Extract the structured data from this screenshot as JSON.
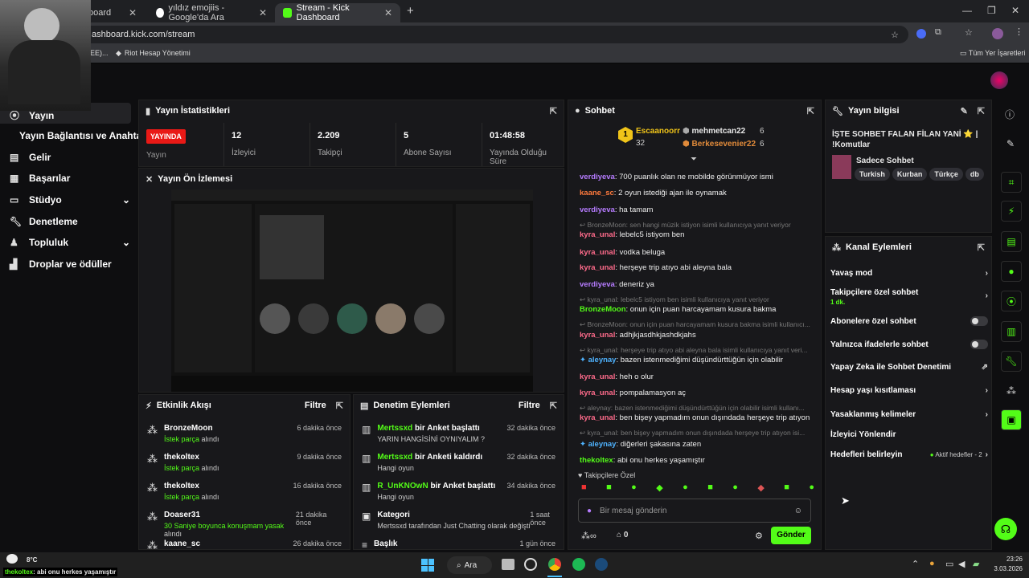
{
  "browser": {
    "tabs": [
      {
        "label": "board"
      },
      {
        "label": "yıldız emojiis - Google'da Ara"
      },
      {
        "label": "Stream - Kick Dashboard"
      }
    ],
    "url": "ashboard.kick.com/stream",
    "bookmarks": [
      "EE)...",
      "Riot Hesap Yönetimi"
    ],
    "all_bookmarks": "Tüm Yer İşaretleri"
  },
  "sidebar": {
    "items": [
      {
        "label": "Yayın",
        "icon": "broadcast-icon"
      },
      {
        "label": "Yayın Bağlantısı ve Anahtarı"
      },
      {
        "label": "Gelir",
        "icon": "revenue-icon"
      },
      {
        "label": "Başarılar",
        "icon": "achievements-icon"
      },
      {
        "label": "Stüdyo",
        "icon": "studio-icon"
      },
      {
        "label": "Denetleme",
        "icon": "wrench-icon"
      },
      {
        "label": "Topluluk",
        "icon": "community-icon"
      },
      {
        "label": "Droplar ve ödüller",
        "icon": "drops-icon"
      }
    ]
  },
  "stats": {
    "title": "Yayın İstatistikleri",
    "live_badge": "YAYINDA",
    "live_label": "Yayın",
    "viewers": {
      "value": "12",
      "label": "İzleyici"
    },
    "followers": {
      "value": "2.209",
      "label": "Takipçi"
    },
    "subs": {
      "value": "5",
      "label": "Abone Sayısı"
    },
    "uptime": {
      "value": "01:48:58",
      "label": "Yayında Olduğu Süre"
    }
  },
  "preview": {
    "title": "Yayın Ön İzlemesi"
  },
  "activity": {
    "title": "Etkinlik Akışı",
    "filter": "Filtre",
    "rows": [
      {
        "user": "BronzeMoon",
        "highlight": "İstek parça",
        "rest": " alındı",
        "time": "6 dakika önce"
      },
      {
        "user": "thekoltex",
        "highlight": "İstek parça",
        "rest": " alındı",
        "time": "9 dakika önce"
      },
      {
        "user": "thekoltex",
        "highlight": "İstek parça",
        "rest": " alındı",
        "time": "16 dakika önce"
      },
      {
        "user": "Doaser31",
        "highlight": "30 Saniye boyunca konuşmam yasak",
        "rest": " alındı",
        "time": "21 dakika önce"
      },
      {
        "user": "kaane_sc",
        "highlight": "",
        "rest": "",
        "time": "26 dakika önce"
      }
    ]
  },
  "modlog": {
    "title": "Denetim Eylemleri",
    "filter": "Filtre",
    "rows": [
      {
        "user": "Mertssxd",
        "action": " bir Anket başlattı",
        "sub": "YARIN HANGİSİNİ OYNIYALIM ?",
        "time": "32 dakika önce"
      },
      {
        "user": "Mertssxd",
        "action": " bir Anketi kaldırdı",
        "sub": "Hangi oyun",
        "time": "32 dakika önce"
      },
      {
        "user": "R_UnKNOwN",
        "action": " bir Anket başlattı",
        "sub": "Hangi oyun",
        "time": "34 dakika önce"
      },
      {
        "user": "Kategori",
        "action": "",
        "sub": "Mertssxd tarafından Just Chatting olarak değiştirildi",
        "time": "1 saat önce"
      },
      {
        "user": "Başlık",
        "action": "",
        "sub": "",
        "time": "1 gün önce"
      }
    ]
  },
  "chat": {
    "title": "Sohbet",
    "leaders": [
      {
        "rank": "1",
        "name": "Escaanoorr",
        "count": "32"
      },
      {
        "name": "mehmetcan22",
        "count": "6"
      },
      {
        "name": "Berkesevenier22",
        "count": "6"
      }
    ],
    "messages": [
      {
        "user": "verdiyeva",
        "color": "#b67cff",
        "text": ": 700 puanlık olan ne mobilde görünmüyor ismi"
      },
      {
        "user": "kaane_sc",
        "color": "#ff7a3d",
        "text": ": 2 oyun istediği ajan ile oynamak"
      },
      {
        "user": "verdiyeva",
        "color": "#b67cff",
        "text": ": ha tamam"
      },
      {
        "reply": "BronzeMoon: sen hangi müzik istiyon isimli kullanıcıya yanıt veriyor"
      },
      {
        "user": "kyra_unal",
        "color": "#ff6b8b",
        "text": ": lebelc5 istiyom ben"
      },
      {
        "user": "kyra_unal",
        "color": "#ff6b8b",
        "text": ": vodka beluga"
      },
      {
        "user": "kyra_unal",
        "color": "#ff6b8b",
        "text": ": herşeye trip atıyo abi aleyna bala"
      },
      {
        "user": "verdiyeva",
        "color": "#b67cff",
        "text": ": deneriz ya"
      },
      {
        "reply": "kyra_unal: lebelc5 istiyom ben isimli kullanıcıya yanıt veriyor"
      },
      {
        "user": "BronzeMoon",
        "color": "#53fc18",
        "text": ": onun için puan harcayamam kusura bakma"
      },
      {
        "reply": "BronzeMoon: onun için puan harcayamam kusura bakma isimli kullanıcı..."
      },
      {
        "user": "kyra_unal",
        "color": "#ff6b8b",
        "text": ": adhjkjasdhkjashdkjahs"
      },
      {
        "reply": "kyra_unal: herşeye trip atıyo abi aleyna bala isimli kullanıcıya yanıt veri..."
      },
      {
        "user": "aleynay",
        "color": "#4fb3ff",
        "text": ": bazen istenmediğimi düşündürttüğün için olabilir"
      },
      {
        "user": "kyra_unal",
        "color": "#ff6b8b",
        "text": ": heh o olur"
      },
      {
        "user": "kyra_unal",
        "color": "#ff6b8b",
        "text": ": pompalamasyon aç"
      },
      {
        "reply": "aleynay: bazen istenmediğimi düşündürttüğün için olabilir isimli kullanı..."
      },
      {
        "user": "kyra_unal",
        "color": "#ff6b8b",
        "text": ": ben bişey yapmadım onun dışındada herşeye trip atıyon"
      },
      {
        "reply": "kyra_unal: ben bişey yapmadım onun dışındada herşeye trip atıyon isi..."
      },
      {
        "user": "aleynay",
        "color": "#4fb3ff",
        "text": ": diğerleri şakasına zaten"
      },
      {
        "user": "thekoltex",
        "color": "#53fc18",
        "text": ": abi onu herkes yaşamıştır"
      }
    ],
    "followers_only": "Takipçilere Özel",
    "placeholder": "Bir mesaj gönderin",
    "points": "0",
    "send": "Gönder"
  },
  "info": {
    "title": "Yayın bilgisi",
    "stream_title": "İŞTE SOHBET FALAN FİLAN YANİ ⭐ | !Komutlar",
    "category": "Sadece Sohbet",
    "tags": [
      "Turkish",
      "Kurban",
      "Türkçe",
      "db"
    ]
  },
  "actions": {
    "title": "Kanal Eylemleri",
    "rows": [
      {
        "label": "Yavaş mod"
      },
      {
        "label": "Takipçilere özel sohbet",
        "sub": "1 dk."
      },
      {
        "label": "Abonelere özel sohbet"
      },
      {
        "label": "Yalnızca ifadelerle sohbet"
      },
      {
        "label": "Yapay Zeka ile Sohbet Denetimi"
      },
      {
        "label": "Hesap yaşı kısıtlaması"
      },
      {
        "label": "Yasaklanmış kelimeler"
      },
      {
        "label": "İzleyici Yönlendir"
      },
      {
        "label": "Hedefleri belirleyin",
        "right": "Aktif hedefler - 2"
      }
    ]
  },
  "taskbar": {
    "weather": "8°C",
    "search": "Ara",
    "time": "23:26",
    "date": "3.03.2026",
    "overlay_user": "thekoltex",
    "overlay_text": ": abi onu herkes yaşamıştır"
  },
  "colors": {
    "accent": "#53fc18",
    "live": "#e91916",
    "panel": "#18181b"
  }
}
